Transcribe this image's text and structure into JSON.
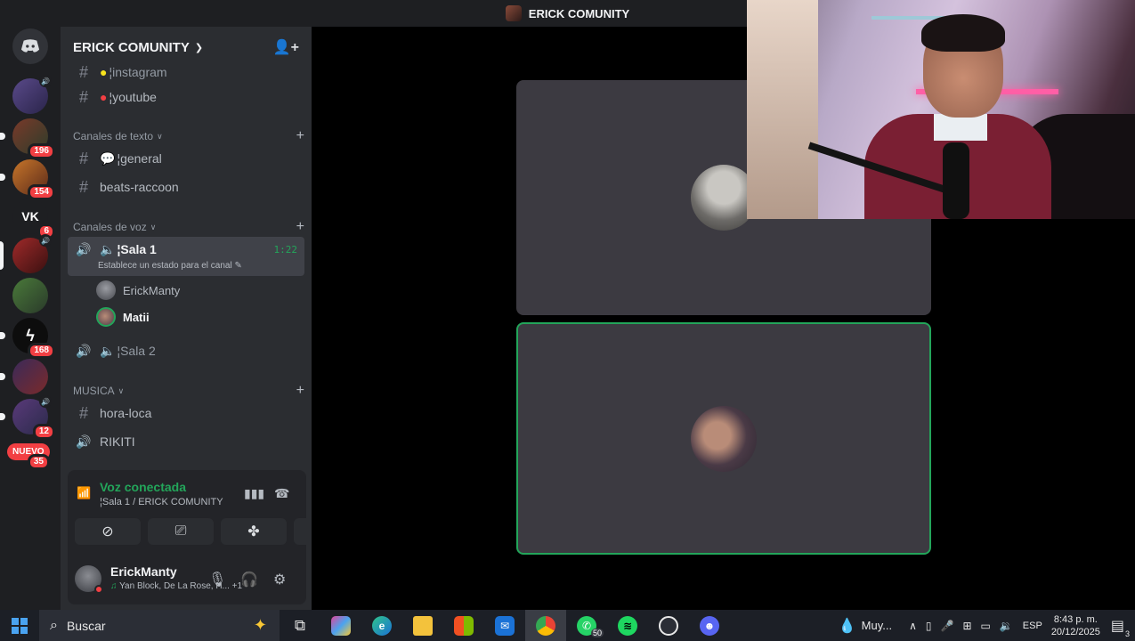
{
  "window_title": "ERICK COMUNITY",
  "server": {
    "name": "ERICK COMUNITY"
  },
  "rail": {
    "badges": [
      "196",
      "154",
      "6",
      "168",
      "12",
      "35"
    ],
    "vk_label": "VK",
    "nuevo_label": "NUEVO"
  },
  "channels": {
    "top": [
      {
        "label": "¦instagram"
      },
      {
        "label": "¦youtube"
      }
    ],
    "text_category": "Canales de texto",
    "text": [
      {
        "label": "¦general"
      },
      {
        "label": "beats-raccoon"
      }
    ],
    "voice_category": "Canales de voz",
    "voice_active": {
      "label": "¦Sala 1",
      "timer": "1:22",
      "status": "Establece un estado para el canal"
    },
    "voice_members": [
      "ErickManty",
      "Matii"
    ],
    "voice_other": {
      "label": "¦Sala 2"
    },
    "music_category": "MUSICA",
    "music": [
      {
        "label": "hora-loca"
      },
      {
        "label": "RIKITI"
      }
    ]
  },
  "voice_panel": {
    "title": "Voz conectada",
    "subtitle": "¦Sala 1 / ERICK COMUNITY"
  },
  "user": {
    "name": "ErickManty",
    "activity": "Yan Block, De La Rose, H...",
    "activity_extra": "+1"
  },
  "taskbar": {
    "search_placeholder": "Buscar",
    "whatsapp_badge": "50",
    "weather": "Muy...",
    "lang": "ESP",
    "time": "8:43 p. m.",
    "date": "20/12/2025",
    "notifications": "3"
  },
  "colors": {
    "accent_green": "#23a55a",
    "badge_red": "#f23f43",
    "sidebar_bg": "#2b2d31"
  }
}
